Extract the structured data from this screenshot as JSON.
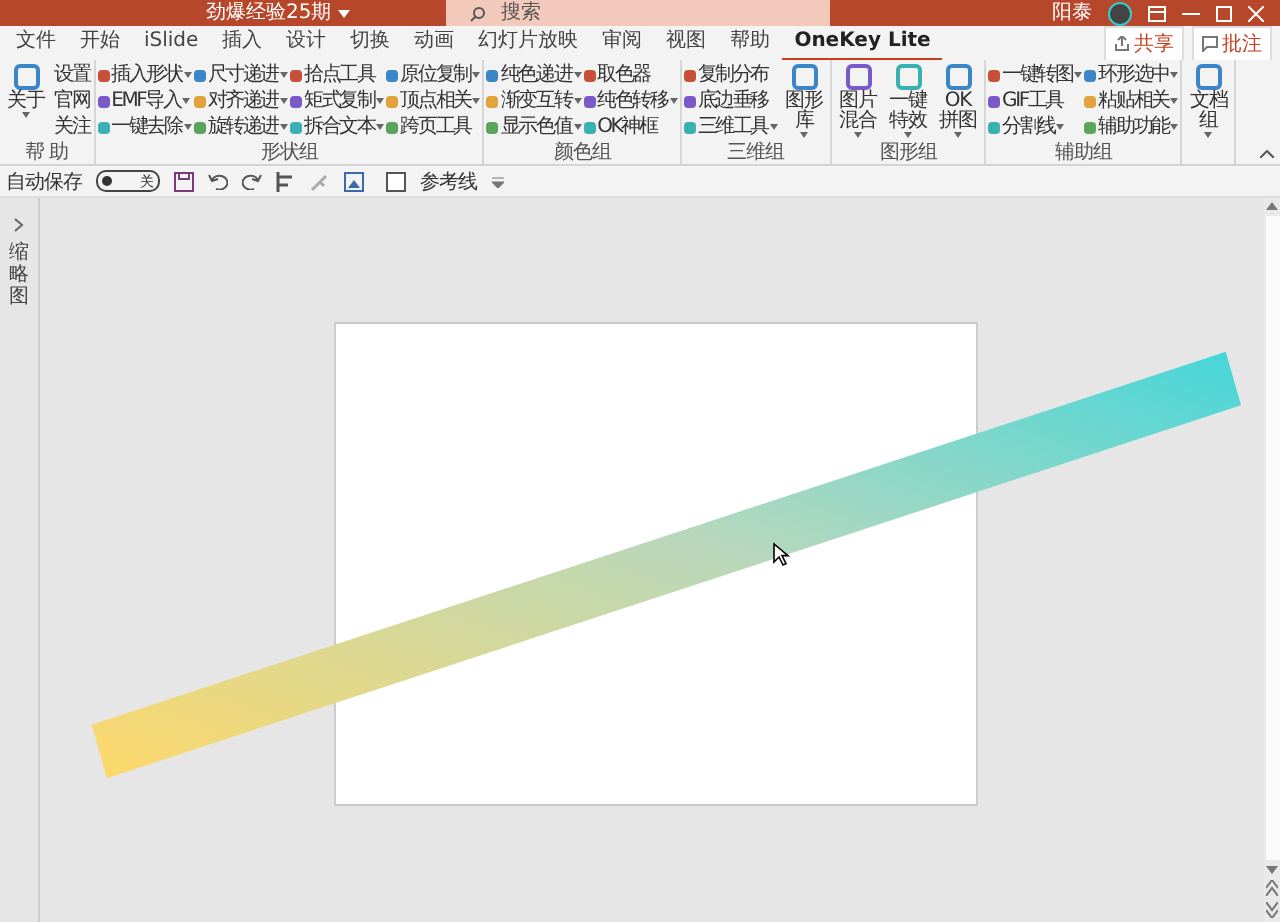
{
  "title_bar": {
    "document_title": "劲爆经验25期",
    "search_placeholder": "搜索",
    "user_name": "阳泰"
  },
  "tabs": [
    {
      "label": "文件",
      "selected": false
    },
    {
      "label": "开始",
      "selected": false
    },
    {
      "label": "iSlide",
      "selected": false
    },
    {
      "label": "插入",
      "selected": false
    },
    {
      "label": "设计",
      "selected": false
    },
    {
      "label": "切换",
      "selected": false
    },
    {
      "label": "动画",
      "selected": false
    },
    {
      "label": "幻灯片放映",
      "selected": false
    },
    {
      "label": "审阅",
      "selected": false
    },
    {
      "label": "视图",
      "selected": false
    },
    {
      "label": "帮助",
      "selected": false
    },
    {
      "label": "OneKey Lite",
      "selected": true
    }
  ],
  "share_buttons": [
    {
      "label": "共享",
      "kind": "share"
    },
    {
      "label": "批注",
      "kind": "comment"
    }
  ],
  "ribbon_groups": [
    {
      "name": "帮 助",
      "items": [
        {
          "kind": "large",
          "label": "关于",
          "dropdown": true
        },
        {
          "kind": "plain",
          "label": "设置",
          "dropdown": false
        },
        {
          "kind": "plain",
          "label": "官网",
          "dropdown": false
        },
        {
          "kind": "plain",
          "label": "关注",
          "dropdown": false
        }
      ]
    },
    {
      "name": "形状组",
      "items": [
        {
          "kind": "small",
          "label": "插入形状",
          "dropdown": true
        },
        {
          "kind": "small",
          "label": "EMF导入",
          "dropdown": true
        },
        {
          "kind": "small",
          "label": "一键去除",
          "dropdown": true
        },
        {
          "kind": "small",
          "label": "尺寸递进",
          "dropdown": true
        },
        {
          "kind": "small",
          "label": "对齐递进",
          "dropdown": true
        },
        {
          "kind": "small",
          "label": "旋转递进",
          "dropdown": true
        },
        {
          "kind": "small",
          "label": "拾点工具",
          "dropdown": false
        },
        {
          "kind": "small",
          "label": "矩式复制",
          "dropdown": true
        },
        {
          "kind": "small",
          "label": "拆合文本",
          "dropdown": true
        },
        {
          "kind": "small",
          "label": "原位复制",
          "dropdown": true
        },
        {
          "kind": "small",
          "label": "顶点相关",
          "dropdown": true
        },
        {
          "kind": "small",
          "label": "跨页工具",
          "dropdown": false
        }
      ]
    },
    {
      "name": "颜色组",
      "items": [
        {
          "kind": "small",
          "label": "纯色递进",
          "dropdown": true
        },
        {
          "kind": "small",
          "label": "渐变互转",
          "dropdown": true
        },
        {
          "kind": "small",
          "label": "显示色值",
          "dropdown": true
        },
        {
          "kind": "small",
          "label": "取色器",
          "dropdown": false
        },
        {
          "kind": "small",
          "label": "纯色转移",
          "dropdown": true
        },
        {
          "kind": "small",
          "label": "OK神框",
          "dropdown": false
        }
      ]
    },
    {
      "name": "三维组",
      "items": [
        {
          "kind": "small",
          "label": "复制分布",
          "dropdown": false
        },
        {
          "kind": "small",
          "label": "底边垂移",
          "dropdown": false
        },
        {
          "kind": "small",
          "label": "三维工具",
          "dropdown": true
        },
        {
          "kind": "large",
          "label": "图形库",
          "dropdown": true
        }
      ]
    },
    {
      "name": "图形组",
      "items": [
        {
          "kind": "large",
          "label": "图片混合",
          "dropdown": true
        },
        {
          "kind": "large",
          "label": "一键特效",
          "dropdown": true
        },
        {
          "kind": "large",
          "label": "OK拼图",
          "dropdown": true
        }
      ]
    },
    {
      "name": "辅助组",
      "items": [
        {
          "kind": "small",
          "label": "一键转图",
          "dropdown": true
        },
        {
          "kind": "small",
          "label": "GIF工具",
          "dropdown": false
        },
        {
          "kind": "small",
          "label": "分割线",
          "dropdown": true
        },
        {
          "kind": "small",
          "label": "环形选中",
          "dropdown": true
        },
        {
          "kind": "small",
          "label": "粘贴相关",
          "dropdown": true
        },
        {
          "kind": "small",
          "label": "辅助功能",
          "dropdown": true
        }
      ]
    },
    {
      "items": [
        {
          "kind": "large",
          "label": "文档组",
          "dropdown": true
        }
      ]
    }
  ],
  "quick_access": {
    "autosave_label": "自动保存",
    "autosave_on": false,
    "autosave_state": "关",
    "guides": {
      "label": "参考线",
      "checked": false
    }
  },
  "sidebar": {
    "label": "缩略图"
  }
}
